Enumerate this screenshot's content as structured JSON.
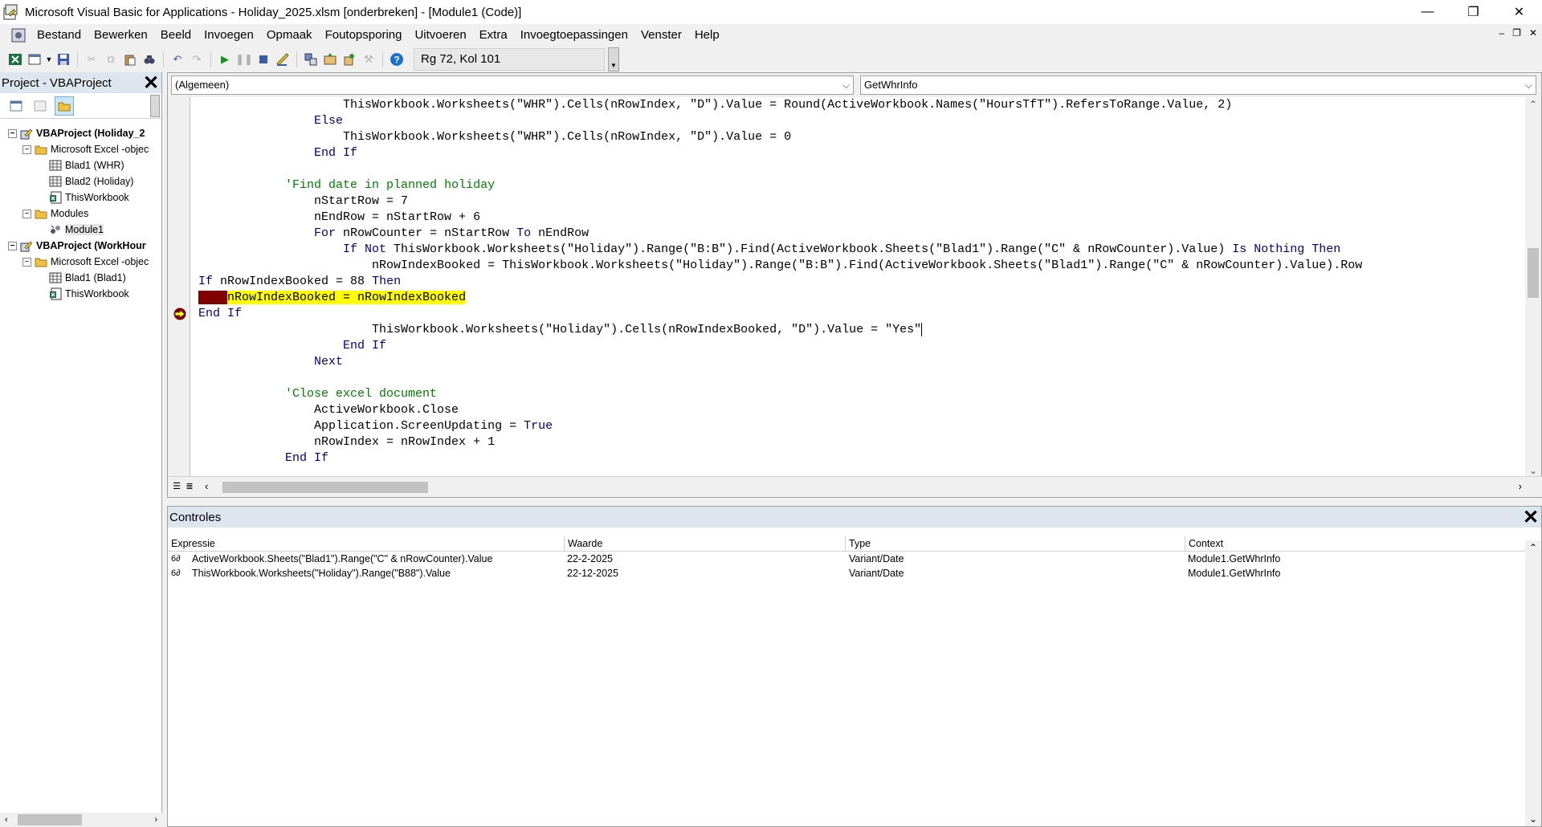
{
  "window": {
    "title": "Microsoft Visual Basic for Applications - Holiday_2025.xlsm [onderbreken] - [Module1 (Code)]",
    "minimize": "—",
    "restore": "❐",
    "close": "✕"
  },
  "menu": {
    "items": [
      "Bestand",
      "Bewerken",
      "Beeld",
      "Invoegen",
      "Opmaak",
      "Foutopsporing",
      "Uitvoeren",
      "Extra",
      "Invoegtoepassingen",
      "Venster",
      "Help"
    ],
    "mdi_minimize": "–",
    "mdi_restore": "❐",
    "mdi_close": "✕"
  },
  "toolbar": {
    "position_status": "Rg 72, Kol 101"
  },
  "project": {
    "title": "Project - VBAProject",
    "close": "✕",
    "tree": [
      {
        "label": "VBAProject (Holiday_2",
        "level": 0,
        "toggle": "−",
        "icon": "vbaproject-icon",
        "bold": true
      },
      {
        "label": "Microsoft Excel -objec",
        "level": 1,
        "toggle": "−",
        "icon": "folder-icon"
      },
      {
        "label": "Blad1 (WHR)",
        "level": 2,
        "icon": "worksheet-icon"
      },
      {
        "label": "Blad2 (Holiday)",
        "level": 2,
        "icon": "worksheet-icon"
      },
      {
        "label": "ThisWorkbook",
        "level": 2,
        "icon": "workbook-icon"
      },
      {
        "label": "Modules",
        "level": 1,
        "toggle": "−",
        "icon": "folder-icon"
      },
      {
        "label": "Module1",
        "level": 2,
        "icon": "module-icon",
        "selected": true
      },
      {
        "label": "VBAProject (WorkHour",
        "level": 0,
        "toggle": "−",
        "icon": "vbaproject-icon",
        "bold": true
      },
      {
        "label": "Microsoft Excel -objec",
        "level": 1,
        "toggle": "−",
        "icon": "folder-icon"
      },
      {
        "label": "Blad1 (Blad1)",
        "level": 2,
        "icon": "worksheet-icon"
      },
      {
        "label": "ThisWorkbook",
        "level": 2,
        "icon": "workbook-icon"
      }
    ]
  },
  "code": {
    "object_combo": "(Algemeen)",
    "procedure_combo": "GetWhrInfo",
    "lines": [
      {
        "indent": 20,
        "parts": [
          [
            "",
            "ThisWorkbook.Worksheets(\"WHR\").Cells(nRowIndex, \"D\").Value = Round(ActiveWorkbook.Names(\"HoursTfT\").RefersToRange.Value, 2)"
          ]
        ]
      },
      {
        "indent": 16,
        "parts": [
          [
            "kw",
            "Else"
          ]
        ]
      },
      {
        "indent": 20,
        "parts": [
          [
            "",
            "ThisWorkbook.Worksheets(\"WHR\").Cells(nRowIndex, \"D\").Value = 0"
          ]
        ]
      },
      {
        "indent": 16,
        "parts": [
          [
            "kw",
            "End If"
          ]
        ]
      },
      {
        "indent": 0,
        "parts": []
      },
      {
        "indent": 12,
        "parts": [
          [
            "cm",
            "'Find date in planned holiday"
          ]
        ]
      },
      {
        "indent": 16,
        "parts": [
          [
            "",
            "nStartRow = 7"
          ]
        ]
      },
      {
        "indent": 16,
        "parts": [
          [
            "",
            "nEndRow = nStartRow + 6"
          ]
        ]
      },
      {
        "indent": 16,
        "parts": [
          [
            "kw",
            "For"
          ],
          [
            "",
            " nRowCounter = nStartRow "
          ],
          [
            "kw",
            "To"
          ],
          [
            "",
            " nEndRow"
          ]
        ]
      },
      {
        "indent": 20,
        "parts": [
          [
            "kw",
            "If Not"
          ],
          [
            "",
            " ThisWorkbook.Worksheets(\"Holiday\").Range(\"B:B\").Find(ActiveWorkbook.Sheets(\"Blad1\").Range(\"C\" & nRowCounter).Value) "
          ],
          [
            "kw",
            "Is Nothing Then"
          ]
        ]
      },
      {
        "indent": 24,
        "parts": [
          [
            "",
            "nRowIndexBooked = ThisWorkbook.Worksheets(\"Holiday\").Range(\"B:B\").Find(ActiveWorkbook.Sheets(\"Blad1\").Range(\"C\" & nRowCounter).Value).Row"
          ]
        ]
      },
      {
        "indent": 0,
        "parts": [
          [
            "kw",
            "If"
          ],
          [
            "",
            " nRowIndexBooked = 88 "
          ],
          [
            "kw",
            "Then"
          ]
        ]
      },
      {
        "indent": 0,
        "parts": [
          [
            "bp",
            "    "
          ],
          [
            "hl",
            "nRowIndexBooked = nRowIndexBooked"
          ]
        ]
      },
      {
        "indent": 0,
        "parts": [
          [
            "kw",
            "End If"
          ]
        ]
      },
      {
        "indent": 24,
        "parts": [
          [
            "",
            "ThisWorkbook.Worksheets(\"Holiday\").Cells(nRowIndexBooked, \"D\").Value = \"Yes\""
          ],
          [
            "caret",
            ""
          ]
        ]
      },
      {
        "indent": 20,
        "parts": [
          [
            "kw",
            "End If"
          ]
        ]
      },
      {
        "indent": 16,
        "parts": [
          [
            "kw",
            "Next"
          ]
        ]
      },
      {
        "indent": 0,
        "parts": []
      },
      {
        "indent": 12,
        "parts": [
          [
            "cm",
            "'Close excel document"
          ]
        ]
      },
      {
        "indent": 16,
        "parts": [
          [
            "",
            "ActiveWorkbook.Close"
          ]
        ]
      },
      {
        "indent": 16,
        "parts": [
          [
            "",
            "Application.ScreenUpdating = "
          ],
          [
            "kw",
            "True"
          ]
        ]
      },
      {
        "indent": 16,
        "parts": [
          [
            "",
            "nRowIndex = nRowIndex + 1"
          ]
        ]
      },
      {
        "indent": 12,
        "parts": [
          [
            "kw",
            "End If"
          ]
        ]
      }
    ]
  },
  "watches": {
    "title": "Controles",
    "close": "✕",
    "columns": [
      "Expressie",
      "Waarde",
      "Type",
      "Context"
    ],
    "rows": [
      {
        "expression": "ActiveWorkbook.Sheets(\"Blad1\").Range(\"C\" & nRowCounter).Value",
        "value": "22-2-2025",
        "type": "Variant/Date",
        "context": "Module1.GetWhrInfo"
      },
      {
        "expression": "ThisWorkbook.Worksheets(\"Holiday\").Range(\"B88\").Value",
        "value": "22-12-2025",
        "type": "Variant/Date",
        "context": "Module1.GetWhrInfo"
      }
    ]
  },
  "colors": {
    "keyword": "#00007f",
    "comment": "#007f00",
    "highlight": "#ffff00",
    "breakpoint": "#800000",
    "panel_header": "#dde6ef"
  }
}
